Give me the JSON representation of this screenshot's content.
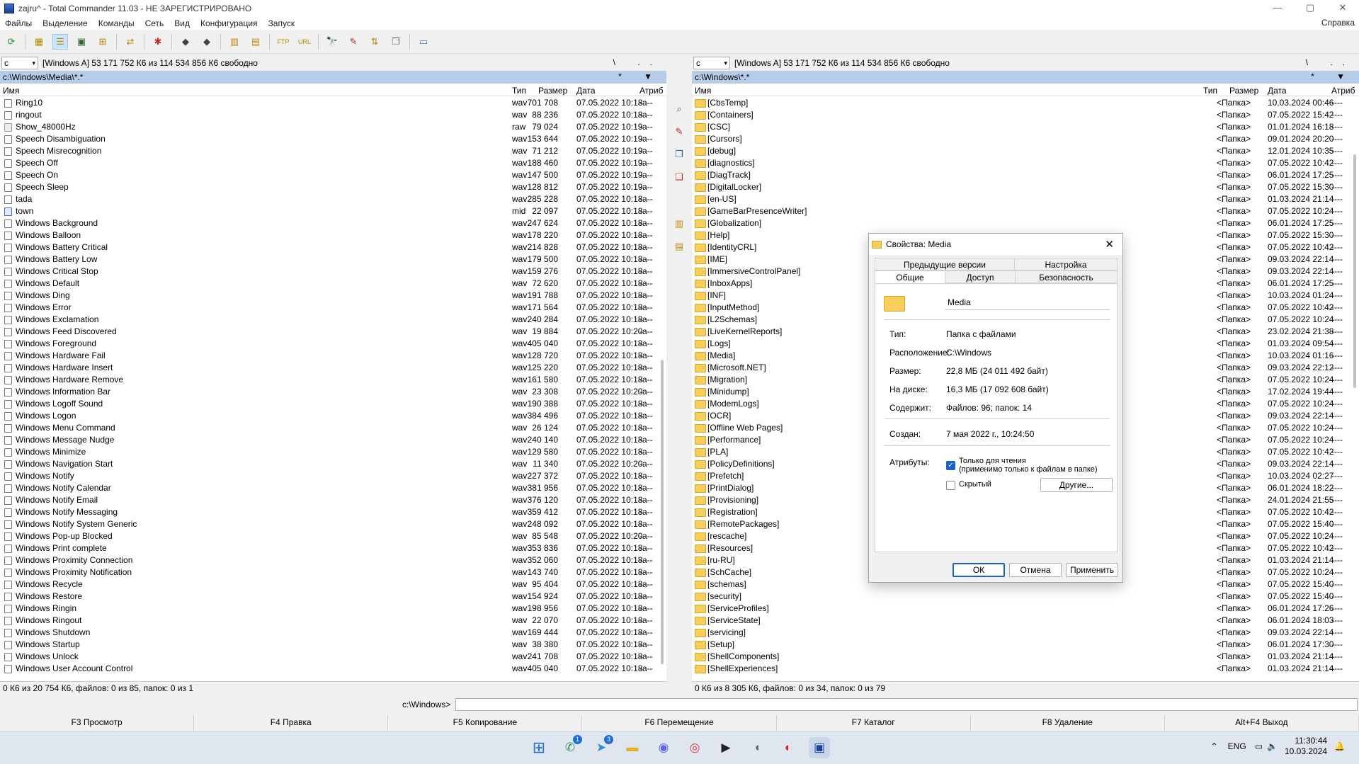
{
  "window": {
    "title": "zajru^ - Total Commander 11.03 - НЕ ЗАРЕГИСТРИРОВАНО",
    "min": "—",
    "max": "▢",
    "close": "✕"
  },
  "menu": [
    "Файлы",
    "Выделение",
    "Команды",
    "Сеть",
    "Вид",
    "Конфигурация",
    "Запуск"
  ],
  "help": "Справка",
  "left": {
    "drive": "c",
    "drive_info": "[Windows A]  53 171 752 К6 из 114 534 856 К6 свободно",
    "nav": "\\ ..",
    "path": "c:\\Windows\\Media\\*.*",
    "path_right": "* ▼",
    "cols": {
      "name": "Имя",
      "type": "Тип",
      "size": "Размер",
      "date": "Дата",
      "attr": "Атриб"
    },
    "rows": [
      [
        "Ring10",
        "wav",
        "701 708",
        "07.05.2022 10:18",
        "-a--"
      ],
      [
        "ringout",
        "wav",
        "88 236",
        "07.05.2022 10:18",
        "-a--"
      ],
      [
        "Show_48000Hz",
        "raw",
        "79 024",
        "07.05.2022 10:19",
        "-a--"
      ],
      [
        "Speech Disambiguation",
        "wav",
        "153 644",
        "07.05.2022 10:19",
        "-a--"
      ],
      [
        "Speech Misrecognition",
        "wav",
        "71 212",
        "07.05.2022 10:19",
        "-a--"
      ],
      [
        "Speech Off",
        "wav",
        "188 460",
        "07.05.2022 10:19",
        "-a--"
      ],
      [
        "Speech On",
        "wav",
        "147 500",
        "07.05.2022 10:19",
        "-a--"
      ],
      [
        "Speech Sleep",
        "wav",
        "128 812",
        "07.05.2022 10:19",
        "-a--"
      ],
      [
        "tada",
        "wav",
        "285 228",
        "07.05.2022 10:18",
        "-a--"
      ],
      [
        "town",
        "mid",
        "22 097",
        "07.05.2022 10:18",
        "-a--"
      ],
      [
        "Windows Background",
        "wav",
        "247 624",
        "07.05.2022 10:18",
        "-a--"
      ],
      [
        "Windows Balloon",
        "wav",
        "178 220",
        "07.05.2022 10:18",
        "-a--"
      ],
      [
        "Windows Battery Critical",
        "wav",
        "214 828",
        "07.05.2022 10:18",
        "-a--"
      ],
      [
        "Windows Battery Low",
        "wav",
        "179 500",
        "07.05.2022 10:18",
        "-a--"
      ],
      [
        "Windows Critical Stop",
        "wav",
        "159 276",
        "07.05.2022 10:18",
        "-a--"
      ],
      [
        "Windows Default",
        "wav",
        "72 620",
        "07.05.2022 10:18",
        "-a--"
      ],
      [
        "Windows Ding",
        "wav",
        "191 788",
        "07.05.2022 10:18",
        "-a--"
      ],
      [
        "Windows Error",
        "wav",
        "171 564",
        "07.05.2022 10:18",
        "-a--"
      ],
      [
        "Windows Exclamation",
        "wav",
        "240 284",
        "07.05.2022 10:18",
        "-a--"
      ],
      [
        "Windows Feed Discovered",
        "wav",
        "19 884",
        "07.05.2022 10:20",
        "-a--"
      ],
      [
        "Windows Foreground",
        "wav",
        "405 040",
        "07.05.2022 10:18",
        "-a--"
      ],
      [
        "Windows Hardware Fail",
        "wav",
        "128 720",
        "07.05.2022 10:18",
        "-a--"
      ],
      [
        "Windows Hardware Insert",
        "wav",
        "125 220",
        "07.05.2022 10:18",
        "-a--"
      ],
      [
        "Windows Hardware Remove",
        "wav",
        "161 580",
        "07.05.2022 10:18",
        "-a--"
      ],
      [
        "Windows Information Bar",
        "wav",
        "23 308",
        "07.05.2022 10:20",
        "-a--"
      ],
      [
        "Windows Logoff Sound",
        "wav",
        "190 388",
        "07.05.2022 10:18",
        "-a--"
      ],
      [
        "Windows Logon",
        "wav",
        "384 496",
        "07.05.2022 10:18",
        "-a--"
      ],
      [
        "Windows Menu Command",
        "wav",
        "26 124",
        "07.05.2022 10:18",
        "-a--"
      ],
      [
        "Windows Message Nudge",
        "wav",
        "240 140",
        "07.05.2022 10:18",
        "-a--"
      ],
      [
        "Windows Minimize",
        "wav",
        "129 580",
        "07.05.2022 10:18",
        "-a--"
      ],
      [
        "Windows Navigation Start",
        "wav",
        "11 340",
        "07.05.2022 10:20",
        "-a--"
      ],
      [
        "Windows Notify",
        "wav",
        "227 372",
        "07.05.2022 10:18",
        "-a--"
      ],
      [
        "Windows Notify Calendar",
        "wav",
        "381 956",
        "07.05.2022 10:18",
        "-a--"
      ],
      [
        "Windows Notify Email",
        "wav",
        "376 120",
        "07.05.2022 10:18",
        "-a--"
      ],
      [
        "Windows Notify Messaging",
        "wav",
        "359 412",
        "07.05.2022 10:18",
        "-a--"
      ],
      [
        "Windows Notify System Generic",
        "wav",
        "248 092",
        "07.05.2022 10:18",
        "-a--"
      ],
      [
        "Windows Pop-up Blocked",
        "wav",
        "85 548",
        "07.05.2022 10:20",
        "-a--"
      ],
      [
        "Windows Print complete",
        "wav",
        "353 836",
        "07.05.2022 10:18",
        "-a--"
      ],
      [
        "Windows Proximity Connection",
        "wav",
        "352 060",
        "07.05.2022 10:18",
        "-a--"
      ],
      [
        "Windows Proximity Notification",
        "wav",
        "143 740",
        "07.05.2022 10:18",
        "-a--"
      ],
      [
        "Windows Recycle",
        "wav",
        "95 404",
        "07.05.2022 10:18",
        "-a--"
      ],
      [
        "Windows Restore",
        "wav",
        "154 924",
        "07.05.2022 10:18",
        "-a--"
      ],
      [
        "Windows Ringin",
        "wav",
        "198 956",
        "07.05.2022 10:18",
        "-a--"
      ],
      [
        "Windows Ringout",
        "wav",
        "22 070",
        "07.05.2022 10:18",
        "-a--"
      ],
      [
        "Windows Shutdown",
        "wav",
        "169 444",
        "07.05.2022 10:18",
        "-a--"
      ],
      [
        "Windows Startup",
        "wav",
        "38 380",
        "07.05.2022 10:18",
        "-a--"
      ],
      [
        "Windows Unlock",
        "wav",
        "241 708",
        "07.05.2022 10:18",
        "-a--"
      ],
      [
        "Windows User Account Control",
        "wav",
        "405 040",
        "07.05.2022 10:18",
        "-a--"
      ]
    ],
    "status": "0 К6 из 20 754 К6, файлов: 0 из 85, папок: 0 из 1"
  },
  "right": {
    "drive": "c",
    "drive_info": "[Windows A]  53 171 752 К6 из 114 534 856 К6 свободно",
    "nav": "\\ ..",
    "path": "c:\\Windows\\*.*",
    "path_right": "* ▼",
    "cols": {
      "name": "Имя",
      "type": "Тип",
      "size": "Размер",
      "date": "Дата",
      "attr": "Атриб"
    },
    "rows": [
      [
        "[CbsTemp]",
        "",
        "<Папка>",
        "10.03.2024 00:46",
        "----"
      ],
      [
        "[Containers]",
        "",
        "<Папка>",
        "07.05.2022 15:42",
        "----"
      ],
      [
        "[CSC]",
        "",
        "<Папка>",
        "01.01.2024 16:18",
        "----"
      ],
      [
        "[Cursors]",
        "",
        "<Папка>",
        "09.01.2024 20:20",
        "----"
      ],
      [
        "[debug]",
        "",
        "<Папка>",
        "12.01.2024 10:35",
        "----"
      ],
      [
        "[diagnostics]",
        "",
        "<Папка>",
        "07.05.2022 10:42",
        "----"
      ],
      [
        "[DiagTrack]",
        "",
        "<Папка>",
        "06.01.2024 17:25",
        "----"
      ],
      [
        "[DigitalLocker]",
        "",
        "<Папка>",
        "07.05.2022 15:30",
        "----"
      ],
      [
        "[en-US]",
        "",
        "<Папка>",
        "01.03.2024 21:14",
        "----"
      ],
      [
        "[GameBarPresenceWriter]",
        "",
        "<Папка>",
        "07.05.2022 10:24",
        "----"
      ],
      [
        "[Globalization]",
        "",
        "<Папка>",
        "06.01.2024 17:25",
        "----"
      ],
      [
        "[Help]",
        "",
        "<Папка>",
        "07.05.2022 15:30",
        "----"
      ],
      [
        "[IdentityCRL]",
        "",
        "<Папка>",
        "07.05.2022 10:42",
        "----"
      ],
      [
        "[IME]",
        "",
        "<Папка>",
        "09.03.2024 22:14",
        "----"
      ],
      [
        "[ImmersiveControlPanel]",
        "",
        "<Папка>",
        "09.03.2024 22:14",
        "----"
      ],
      [
        "[InboxApps]",
        "",
        "<Папка>",
        "06.01.2024 17:25",
        "----"
      ],
      [
        "[INF]",
        "",
        "<Папка>",
        "10.03.2024 01:24",
        "----"
      ],
      [
        "[InputMethod]",
        "",
        "<Папка>",
        "07.05.2022 10:42",
        "----"
      ],
      [
        "[L2Schemas]",
        "",
        "<Папка>",
        "07.05.2022 10:24",
        "----"
      ],
      [
        "[LiveKernelReports]",
        "",
        "<Папка>",
        "23.02.2024 21:38",
        "----"
      ],
      [
        "[Logs]",
        "",
        "<Папка>",
        "01.03.2024 09:54",
        "----"
      ],
      [
        "[Media]",
        "",
        "<Папка>",
        "10.03.2024 01:16",
        "----"
      ],
      [
        "[Microsoft.NET]",
        "",
        "<Папка>",
        "09.03.2024 22:12",
        "----"
      ],
      [
        "[Migration]",
        "",
        "<Папка>",
        "07.05.2022 10:24",
        "----"
      ],
      [
        "[Minidump]",
        "",
        "<Папка>",
        "17.02.2024 19:44",
        "----"
      ],
      [
        "[ModemLogs]",
        "",
        "<Папка>",
        "07.05.2022 10:24",
        "----"
      ],
      [
        "[OCR]",
        "",
        "<Папка>",
        "09.03.2024 22:14",
        "----"
      ],
      [
        "[Offline Web Pages]",
        "",
        "<Папка>",
        "07.05.2022 10:24",
        "----"
      ],
      [
        "[Performance]",
        "",
        "<Папка>",
        "07.05.2022 10:24",
        "----"
      ],
      [
        "[PLA]",
        "",
        "<Папка>",
        "07.05.2022 10:42",
        "----"
      ],
      [
        "[PolicyDefinitions]",
        "",
        "<Папка>",
        "09.03.2024 22:14",
        "----"
      ],
      [
        "[Prefetch]",
        "",
        "<Папка>",
        "10.03.2024 02:27",
        "----"
      ],
      [
        "[PrintDialog]",
        "",
        "<Папка>",
        "06.01.2024 18:22",
        "----"
      ],
      [
        "[Provisioning]",
        "",
        "<Папка>",
        "24.01.2024 21:55",
        "----"
      ],
      [
        "[Registration]",
        "",
        "<Папка>",
        "07.05.2022 10:42",
        "----"
      ],
      [
        "[RemotePackages]",
        "",
        "<Папка>",
        "07.05.2022 15:40",
        "----"
      ],
      [
        "[rescache]",
        "",
        "<Папка>",
        "07.05.2022 10:24",
        "----"
      ],
      [
        "[Resources]",
        "",
        "<Папка>",
        "07.05.2022 10:42",
        "----"
      ],
      [
        "[ru-RU]",
        "",
        "<Папка>",
        "01.03.2024 21:14",
        "----"
      ],
      [
        "[SchCache]",
        "",
        "<Папка>",
        "07.05.2022 10:24",
        "----"
      ],
      [
        "[schemas]",
        "",
        "<Папка>",
        "07.05.2022 15:40",
        "----"
      ],
      [
        "[security]",
        "",
        "<Папка>",
        "07.05.2022 15:40",
        "----"
      ],
      [
        "[ServiceProfiles]",
        "",
        "<Папка>",
        "06.01.2024 17:26",
        "----"
      ],
      [
        "[ServiceState]",
        "",
        "<Папка>",
        "06.01.2024 18:03",
        "----"
      ],
      [
        "[servicing]",
        "",
        "<Папка>",
        "09.03.2024 22:14",
        "----"
      ],
      [
        "[Setup]",
        "",
        "<Папка>",
        "06.01.2024 17:30",
        "----"
      ],
      [
        "[ShellComponents]",
        "",
        "<Папка>",
        "01.03.2024 21:14",
        "----"
      ],
      [
        "[ShellExperiences]",
        "",
        "<Папка>",
        "01.03.2024 21:14",
        "----"
      ]
    ],
    "status": "0 К6 из 8 305 К6, файлов: 0 из 34, папок: 0 из 79"
  },
  "cmd": {
    "label": "c:\\Windows>",
    "value": ""
  },
  "fkeys": [
    "F3 Просмотр",
    "F4 Правка",
    "F5 Копирование",
    "F6 Перемещение",
    "F7 Каталог",
    "F8 Удаление",
    "Alt+F4 Выход"
  ],
  "dialog": {
    "title": "Свойства: Media",
    "tabs_top": [
      "Предыдущие версии",
      "Настройка"
    ],
    "tabs_bottom": [
      "Общие",
      "Доступ",
      "Безопасность"
    ],
    "name": "Media",
    "props": [
      [
        "Тип:",
        "Папка с файлами"
      ],
      [
        "Расположение:",
        "C:\\Windows"
      ],
      [
        "Размер:",
        "22,8 МБ (24 011 492 байт)"
      ],
      [
        "На диске:",
        "16,3 МБ (17 092 608 байт)"
      ],
      [
        "Содержит:",
        "Файлов: 96; папок: 14"
      ]
    ],
    "created_label": "Создан:",
    "created_value": "7 мая 2022 г., 10:24:50",
    "attrs_label": "Атрибуты:",
    "readonly_label": "Только для чтения",
    "readonly_note": "(применимо только к файлам в папке)",
    "hidden_label": "Скрытый",
    "other_btn": "Другие...",
    "ok": "ОК",
    "cancel": "Отмена",
    "apply": "Применить"
  },
  "taskbar": {
    "badges": [
      "1",
      "3"
    ],
    "lang": "ENG",
    "time": "11:30:44",
    "date": "10.03.2024"
  }
}
